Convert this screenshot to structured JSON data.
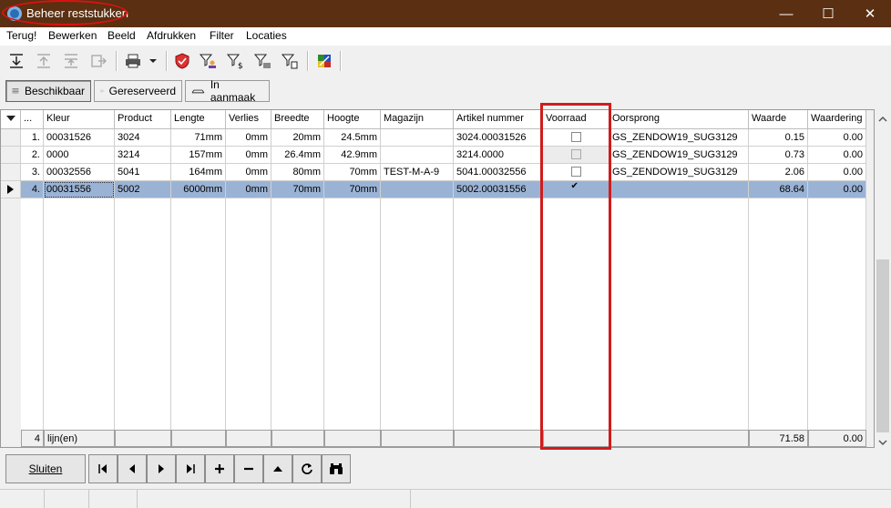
{
  "window": {
    "title": "Beheer reststukken",
    "minimize": "—",
    "maximize": "☐",
    "close": "✕"
  },
  "menu": [
    "Terug!",
    "Bewerken",
    "Beeld",
    "Afdrukken",
    "Filter",
    "Locaties"
  ],
  "tabs": [
    {
      "label": "Beschikbaar",
      "icon": "list-icon",
      "active": true
    },
    {
      "label": "Gereserveerd",
      "icon": "reserved-icon",
      "active": false
    },
    {
      "label": "In aanmaak",
      "icon": "in-progress-icon",
      "active": false
    }
  ],
  "grid": {
    "columns": [
      "...",
      "Kleur",
      "Product",
      "Lengte",
      "Verlies",
      "Breedte",
      "Hoogte",
      "Magazijn",
      "Artikel nummer",
      "Voorraad",
      "Oorsprong",
      "Waarde",
      "Waardering"
    ],
    "rows": [
      {
        "num": "1.",
        "kleur": "00031526",
        "product": "3024",
        "lengte": "71mm",
        "verlies": "0mm",
        "breedte": "20mm",
        "hoogte": "24.5mm",
        "magazijn": "",
        "artikel": "3024.00031526",
        "voorraad": false,
        "oorsprong": "GS_ZENDOW19_SUG3129",
        "waarde": "0.15",
        "waardering": "0.00"
      },
      {
        "num": "2.",
        "kleur": "0000",
        "product": "3214",
        "lengte": "157mm",
        "verlies": "0mm",
        "breedte": "26.4mm",
        "hoogte": "42.9mm",
        "magazijn": "",
        "artikel": "3214.0000",
        "voorraad": false,
        "oorsprong": "GS_ZENDOW19_SUG3129",
        "waarde": "0.73",
        "waardering": "0.00"
      },
      {
        "num": "3.",
        "kleur": "00032556",
        "product": "5041",
        "lengte": "164mm",
        "verlies": "0mm",
        "breedte": "80mm",
        "hoogte": "70mm",
        "magazijn": "TEST-M-A-9",
        "artikel": "5041.00032556",
        "voorraad": false,
        "oorsprong": "GS_ZENDOW19_SUG3129",
        "waarde": "2.06",
        "waardering": "0.00"
      },
      {
        "num": "4.",
        "kleur": "00031556",
        "product": "5002",
        "lengte": "6000mm",
        "verlies": "0mm",
        "breedte": "70mm",
        "hoogte": "70mm",
        "magazijn": "",
        "artikel": "5002.00031556",
        "voorraad": true,
        "oorsprong": "",
        "waarde": "68.64",
        "waardering": "0.00"
      }
    ],
    "footer": {
      "count": "4",
      "count_label": "lijn(en)",
      "waarde_total": "71.58",
      "waardering_total": "0.00"
    }
  },
  "bottom": {
    "close_label": "Sluiten"
  }
}
